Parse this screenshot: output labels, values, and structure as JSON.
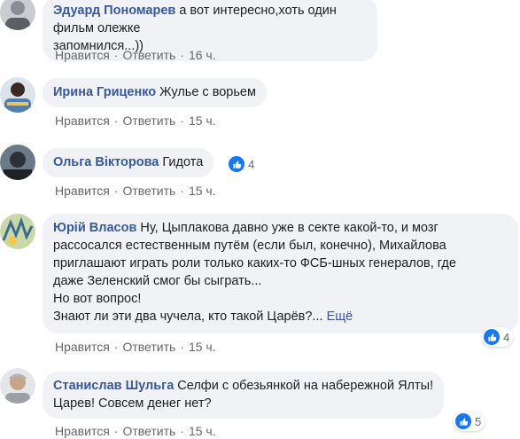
{
  "actions": {
    "like": "Нравится",
    "reply": "Ответить",
    "separator": "·"
  },
  "comments": [
    {
      "author": "Эдуард Пономарев",
      "text_line1": "а вот интересно,хоть один фильм олежке",
      "text_line2": "запомнился...))",
      "time": "16 ч."
    },
    {
      "author": "Ирина Гриценко",
      "text": "Жулье с ворьем",
      "time": "15 ч."
    },
    {
      "author": "Ольга Вікторова",
      "text": "Гидота",
      "time": "15 ч.",
      "reactions": "4"
    },
    {
      "author": "Юрій Власов",
      "line1": "Ну, Цыплакова давно уже в секте какой-то, и мозг",
      "line2": "рассосался естественным путём (если был, конечно), Михайлова",
      "line3": "приглашают играть роли только каких-то ФСБ-шных генералов, где",
      "line4": "даже Зеленский смог бы сыграть...",
      "line5": "Но вот вопрос!",
      "line6": "Знают ли эти два чучела, кто такой Царёв?...",
      "more": "Ещё",
      "time": "15 ч.",
      "reactions": "4"
    },
    {
      "author": "Станислав Шульга",
      "line1": "Селфи с обезьянкой на набережной Ялты!",
      "line2": "Царев! Совсем денег нет?",
      "time": "15 ч.",
      "reactions": "5"
    }
  ],
  "icons": {
    "like": "like-thumb-icon"
  },
  "colors": {
    "author": "#385898",
    "bubble": "#f0f2f5",
    "meta": "#65676b",
    "like": "#1877f2"
  }
}
